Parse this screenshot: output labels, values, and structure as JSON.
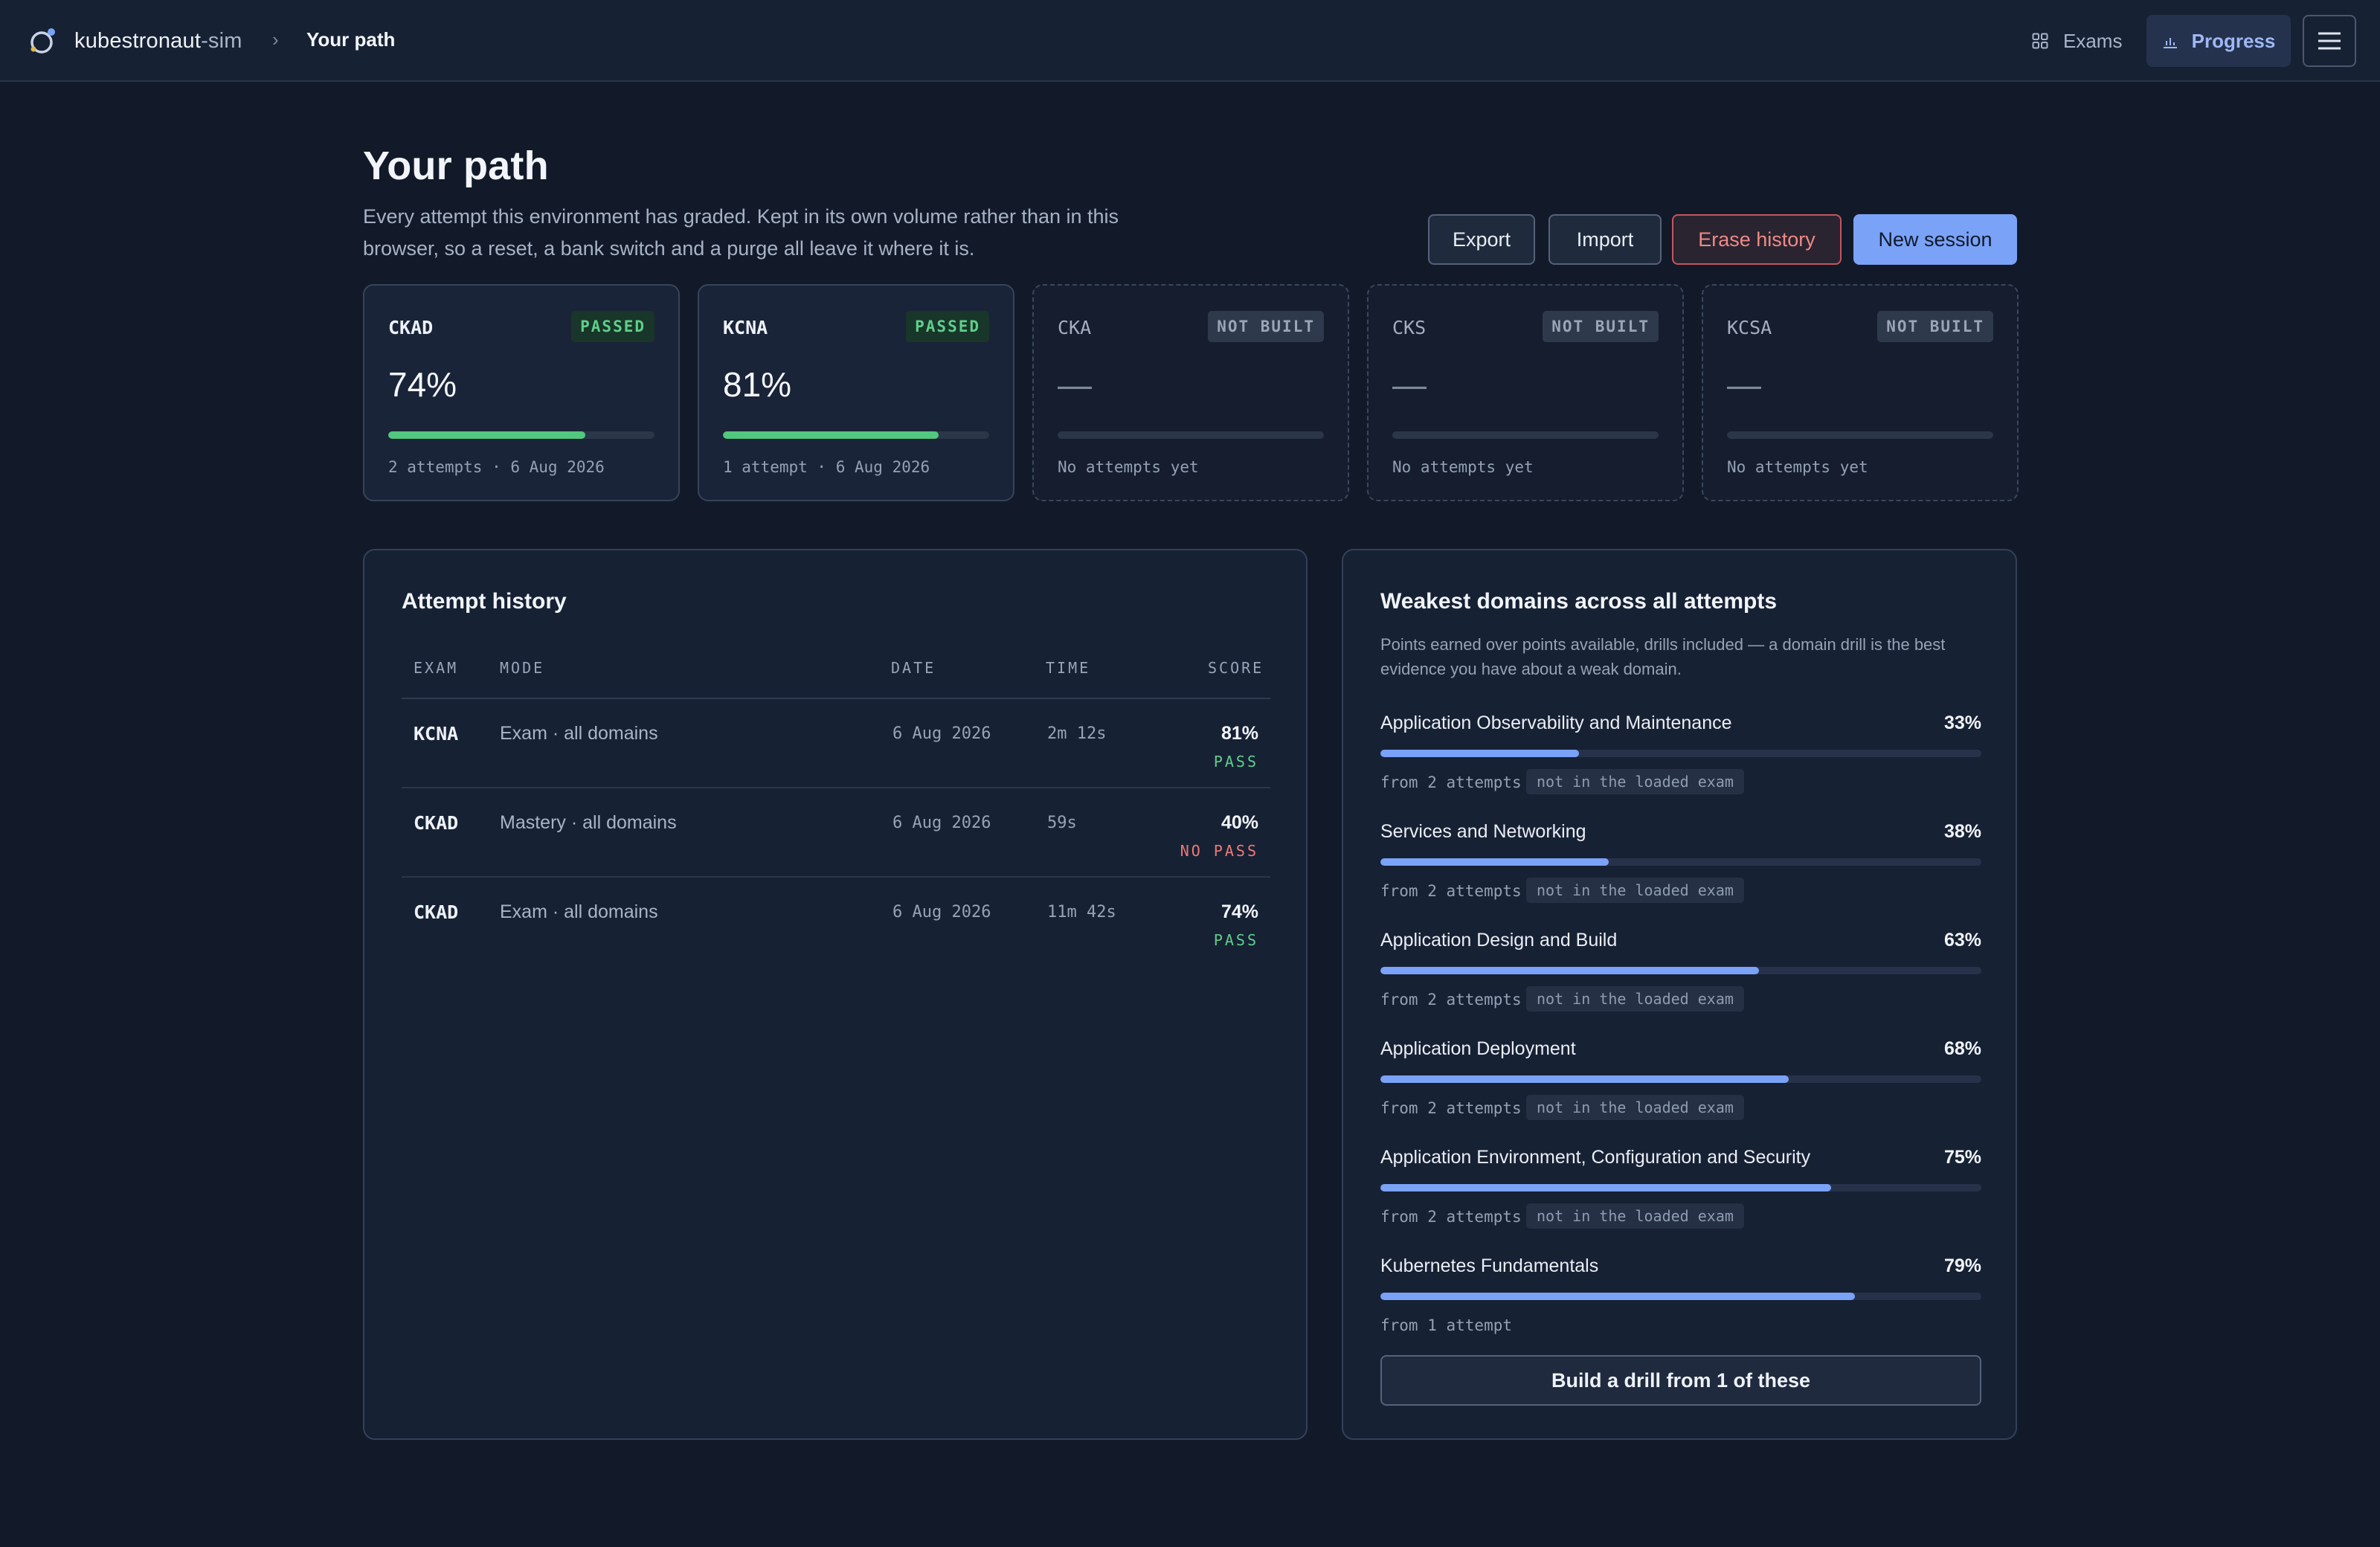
{
  "topbar": {
    "brand_main": "kubestronaut",
    "brand_suffix": "-sim",
    "crumb_sep": "›",
    "crumb": "Your path",
    "nav_exams": "Exams",
    "nav_progress": "Progress",
    "colors": {
      "accent": "#7aa2f7",
      "background": "#121a2a",
      "pass": "#52c77e",
      "danger": "#c2575b"
    }
  },
  "header": {
    "title": "Your path",
    "description": "Every attempt this environment has graded. Kept in its own volume rather than in this browser, so a reset, a bank switch and a purge all leave it where it is.",
    "buttons": {
      "export": "Export",
      "import": "Import",
      "erase": "Erase history",
      "new_session": "New session"
    }
  },
  "exams": [
    {
      "code": "CKAD",
      "badge": "PASSED",
      "score": "74%",
      "progress": 0.74,
      "meta": "2 attempts · 6 Aug 2026"
    },
    {
      "code": "KCNA",
      "badge": "PASSED",
      "score": "81%",
      "progress": 0.81,
      "meta": "1 attempt · 6 Aug 2026"
    },
    {
      "code": "CKA",
      "badge": "NOT BUILT",
      "score": "—",
      "progress": 0,
      "meta": "No attempts yet"
    },
    {
      "code": "CKS",
      "badge": "NOT BUILT",
      "score": "—",
      "progress": 0,
      "meta": "No attempts yet"
    },
    {
      "code": "KCSA",
      "badge": "NOT BUILT",
      "score": "—",
      "progress": 0,
      "meta": "No attempts yet"
    }
  ],
  "history": {
    "title": "Attempt history",
    "columns": {
      "exam": "EXAM",
      "mode": "MODE",
      "date": "DATE",
      "time": "TIME",
      "score": "SCORE"
    },
    "rows": [
      {
        "exam": "KCNA",
        "mode": "Exam · all domains",
        "date": "6 Aug 2026",
        "time": "2m 12s",
        "score": "81%",
        "result": "PASS"
      },
      {
        "exam": "CKAD",
        "mode": "Mastery · all domains",
        "date": "6 Aug 2026",
        "time": "59s",
        "score": "40%",
        "result": "NO PASS"
      },
      {
        "exam": "CKAD",
        "mode": "Exam · all domains",
        "date": "6 Aug 2026",
        "time": "11m 42s",
        "score": "74%",
        "result": "PASS"
      }
    ]
  },
  "weak": {
    "title": "Weakest domains across all attempts",
    "description": "Points earned over points available, drills included — a domain drill is the best evidence you have about a weak domain.",
    "domains": [
      {
        "name": "Application Observability and Maintenance",
        "pct": "33%",
        "value": 0.33,
        "from": "from 2 attempts",
        "tag": "not in the loaded exam"
      },
      {
        "name": "Services and Networking",
        "pct": "38%",
        "value": 0.38,
        "from": "from 2 attempts",
        "tag": "not in the loaded exam"
      },
      {
        "name": "Application Design and Build",
        "pct": "63%",
        "value": 0.63,
        "from": "from 2 attempts",
        "tag": "not in the loaded exam"
      },
      {
        "name": "Application Deployment",
        "pct": "68%",
        "value": 0.68,
        "from": "from 2 attempts",
        "tag": "not in the loaded exam"
      },
      {
        "name": "Application Environment, Configuration and Security",
        "pct": "75%",
        "value": 0.75,
        "from": "from 2 attempts",
        "tag": "not in the loaded exam"
      },
      {
        "name": "Kubernetes Fundamentals",
        "pct": "79%",
        "value": 0.79,
        "from": "from 1 attempt",
        "tag": ""
      }
    ],
    "drill_button": "Build a drill from 1 of these"
  }
}
